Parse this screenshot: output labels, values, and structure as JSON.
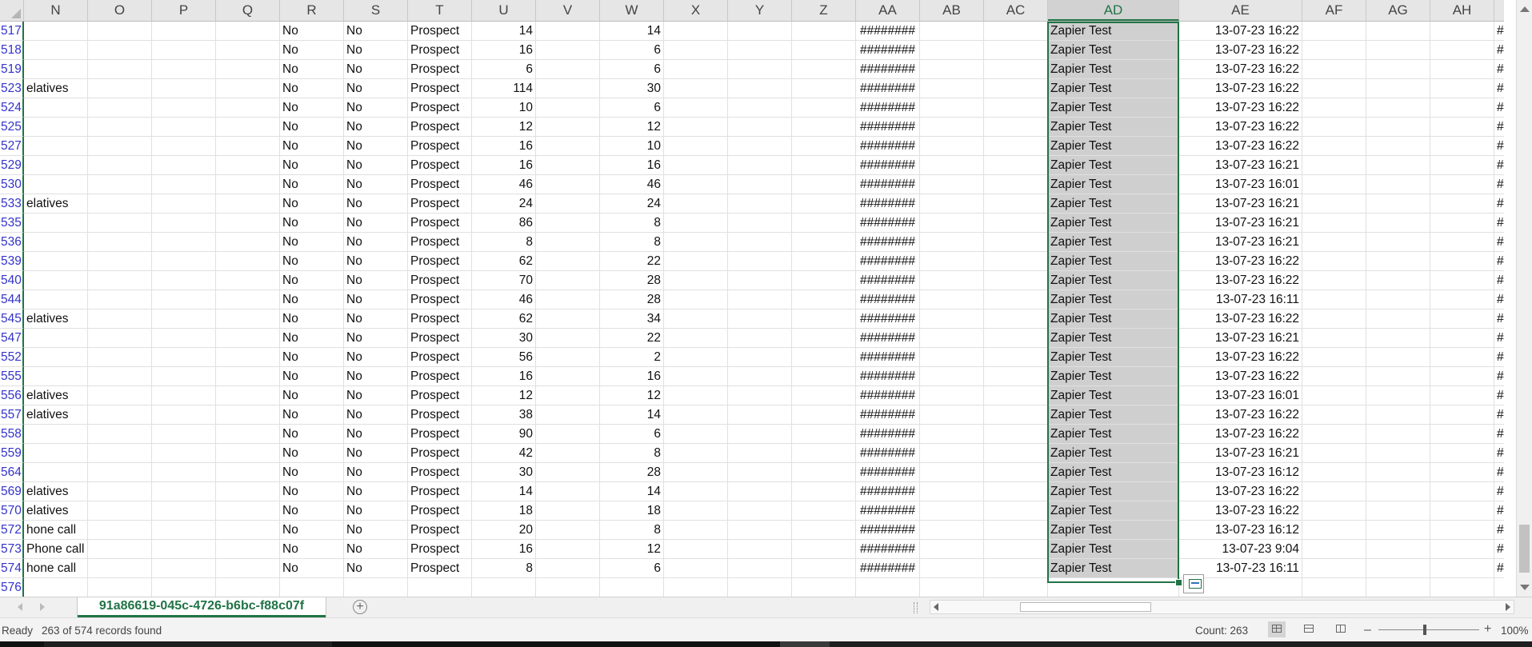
{
  "columns": [
    "N",
    "O",
    "P",
    "Q",
    "R",
    "S",
    "T",
    "U",
    "V",
    "W",
    "X",
    "Y",
    "Z",
    "AA",
    "AB",
    "AC",
    "AD",
    "AE",
    "AF",
    "AG",
    "AH"
  ],
  "selected_column": "AD",
  "rows": [
    {
      "num": "517",
      "n": "",
      "r": "No",
      "s": "No",
      "t": "Prospect",
      "u": "14",
      "w": "14",
      "aa": "########",
      "ad": "Zapier Test",
      "ae": "13-07-23 16:22",
      "ai": "##"
    },
    {
      "num": "518",
      "n": "",
      "r": "No",
      "s": "No",
      "t": "Prospect",
      "u": "16",
      "w": "6",
      "aa": "########",
      "ad": "Zapier Test",
      "ae": "13-07-23 16:22",
      "ai": "##"
    },
    {
      "num": "519",
      "n": "",
      "r": "No",
      "s": "No",
      "t": "Prospect",
      "u": "6",
      "w": "6",
      "aa": "########",
      "ad": "Zapier Test",
      "ae": "13-07-23 16:22",
      "ai": "##"
    },
    {
      "num": "523",
      "n": "elatives",
      "r": "No",
      "s": "No",
      "t": "Prospect",
      "u": "114",
      "w": "30",
      "aa": "########",
      "ad": "Zapier Test",
      "ae": "13-07-23 16:22",
      "ai": "##"
    },
    {
      "num": "524",
      "n": "",
      "r": "No",
      "s": "No",
      "t": "Prospect",
      "u": "10",
      "w": "6",
      "aa": "########",
      "ad": "Zapier Test",
      "ae": "13-07-23 16:22",
      "ai": "##"
    },
    {
      "num": "525",
      "n": "",
      "r": "No",
      "s": "No",
      "t": "Prospect",
      "u": "12",
      "w": "12",
      "aa": "########",
      "ad": "Zapier Test",
      "ae": "13-07-23 16:22",
      "ai": "##"
    },
    {
      "num": "527",
      "n": "",
      "r": "No",
      "s": "No",
      "t": "Prospect",
      "u": "16",
      "w": "10",
      "aa": "########",
      "ad": "Zapier Test",
      "ae": "13-07-23 16:22",
      "ai": "##"
    },
    {
      "num": "529",
      "n": "",
      "r": "No",
      "s": "No",
      "t": "Prospect",
      "u": "16",
      "w": "16",
      "aa": "########",
      "ad": "Zapier Test",
      "ae": "13-07-23 16:21",
      "ai": "##"
    },
    {
      "num": "530",
      "n": "",
      "r": "No",
      "s": "No",
      "t": "Prospect",
      "u": "46",
      "w": "46",
      "aa": "########",
      "ad": "Zapier Test",
      "ae": "13-07-23 16:01",
      "ai": "##"
    },
    {
      "num": "533",
      "n": "elatives",
      "r": "No",
      "s": "No",
      "t": "Prospect",
      "u": "24",
      "w": "24",
      "aa": "########",
      "ad": "Zapier Test",
      "ae": "13-07-23 16:21",
      "ai": "##"
    },
    {
      "num": "535",
      "n": "",
      "r": "No",
      "s": "No",
      "t": "Prospect",
      "u": "86",
      "w": "8",
      "aa": "########",
      "ad": "Zapier Test",
      "ae": "13-07-23 16:21",
      "ai": "##"
    },
    {
      "num": "536",
      "n": "",
      "r": "No",
      "s": "No",
      "t": "Prospect",
      "u": "8",
      "w": "8",
      "aa": "########",
      "ad": "Zapier Test",
      "ae": "13-07-23 16:21",
      "ai": "##"
    },
    {
      "num": "539",
      "n": "",
      "r": "No",
      "s": "No",
      "t": "Prospect",
      "u": "62",
      "w": "22",
      "aa": "########",
      "ad": "Zapier Test",
      "ae": "13-07-23 16:22",
      "ai": "##"
    },
    {
      "num": "540",
      "n": "",
      "r": "No",
      "s": "No",
      "t": "Prospect",
      "u": "70",
      "w": "28",
      "aa": "########",
      "ad": "Zapier Test",
      "ae": "13-07-23 16:22",
      "ai": "##"
    },
    {
      "num": "544",
      "n": "",
      "r": "No",
      "s": "No",
      "t": "Prospect",
      "u": "46",
      "w": "28",
      "aa": "########",
      "ad": "Zapier Test",
      "ae": "13-07-23 16:11",
      "ai": "##"
    },
    {
      "num": "545",
      "n": "elatives",
      "r": "No",
      "s": "No",
      "t": "Prospect",
      "u": "62",
      "w": "34",
      "aa": "########",
      "ad": "Zapier Test",
      "ae": "13-07-23 16:22",
      "ai": "##"
    },
    {
      "num": "547",
      "n": "",
      "r": "No",
      "s": "No",
      "t": "Prospect",
      "u": "30",
      "w": "22",
      "aa": "########",
      "ad": "Zapier Test",
      "ae": "13-07-23 16:21",
      "ai": "##"
    },
    {
      "num": "552",
      "n": "",
      "r": "No",
      "s": "No",
      "t": "Prospect",
      "u": "56",
      "w": "2",
      "aa": "########",
      "ad": "Zapier Test",
      "ae": "13-07-23 16:22",
      "ai": "##"
    },
    {
      "num": "555",
      "n": "",
      "r": "No",
      "s": "No",
      "t": "Prospect",
      "u": "16",
      "w": "16",
      "aa": "########",
      "ad": "Zapier Test",
      "ae": "13-07-23 16:22",
      "ai": "##"
    },
    {
      "num": "556",
      "n": "elatives",
      "r": "No",
      "s": "No",
      "t": "Prospect",
      "u": "12",
      "w": "12",
      "aa": "########",
      "ad": "Zapier Test",
      "ae": "13-07-23 16:01",
      "ai": "##"
    },
    {
      "num": "557",
      "n": "elatives",
      "r": "No",
      "s": "No",
      "t": "Prospect",
      "u": "38",
      "w": "14",
      "aa": "########",
      "ad": "Zapier Test",
      "ae": "13-07-23 16:22",
      "ai": "##"
    },
    {
      "num": "558",
      "n": "",
      "r": "No",
      "s": "No",
      "t": "Prospect",
      "u": "90",
      "w": "6",
      "aa": "########",
      "ad": "Zapier Test",
      "ae": "13-07-23 16:22",
      "ai": "##"
    },
    {
      "num": "559",
      "n": "",
      "r": "No",
      "s": "No",
      "t": "Prospect",
      "u": "42",
      "w": "8",
      "aa": "########",
      "ad": "Zapier Test",
      "ae": "13-07-23 16:21",
      "ai": "##"
    },
    {
      "num": "564",
      "n": "",
      "r": "No",
      "s": "No",
      "t": "Prospect",
      "u": "30",
      "w": "28",
      "aa": "########",
      "ad": "Zapier Test",
      "ae": "13-07-23 16:12",
      "ai": "##"
    },
    {
      "num": "569",
      "n": "elatives",
      "r": "No",
      "s": "No",
      "t": "Prospect",
      "u": "14",
      "w": "14",
      "aa": "########",
      "ad": "Zapier Test",
      "ae": "13-07-23 16:22",
      "ai": "##"
    },
    {
      "num": "570",
      "n": "elatives",
      "r": "No",
      "s": "No",
      "t": "Prospect",
      "u": "18",
      "w": "18",
      "aa": "########",
      "ad": "Zapier Test",
      "ae": "13-07-23 16:22",
      "ai": "##"
    },
    {
      "num": "572",
      "n": "hone call",
      "r": "No",
      "s": "No",
      "t": "Prospect",
      "u": "20",
      "w": "8",
      "aa": "########",
      "ad": "Zapier Test",
      "ae": "13-07-23 16:12",
      "ai": "##"
    },
    {
      "num": "573",
      "n": "Phone call",
      "r": "No",
      "s": "No",
      "t": "Prospect",
      "u": "16",
      "w": "12",
      "aa": "########",
      "ad": "Zapier Test",
      "ae": "13-07-23 9:04",
      "ai": "##"
    },
    {
      "num": "574",
      "n": "hone call",
      "r": "No",
      "s": "No",
      "t": "Prospect",
      "u": "8",
      "w": "6",
      "aa": "########",
      "ad": "Zapier Test",
      "ae": "13-07-23 16:11",
      "ai": "##"
    },
    {
      "num": "576",
      "n": "",
      "r": "",
      "s": "",
      "t": "",
      "u": "",
      "w": "",
      "aa": "",
      "ad": "",
      "ae": "",
      "ai": ""
    }
  ],
  "sheet_tab": "91a86619-045c-4726-b6bc-f88c07f",
  "add_sheet_label": "+",
  "status": {
    "ready": "Ready",
    "records": "263 of 574 records found",
    "count": "Count: 263",
    "zoom": "100%",
    "zoom_out": "–",
    "zoom_in": "+"
  },
  "colors": {
    "accent": "#217346",
    "row_number": "#3333cc"
  }
}
